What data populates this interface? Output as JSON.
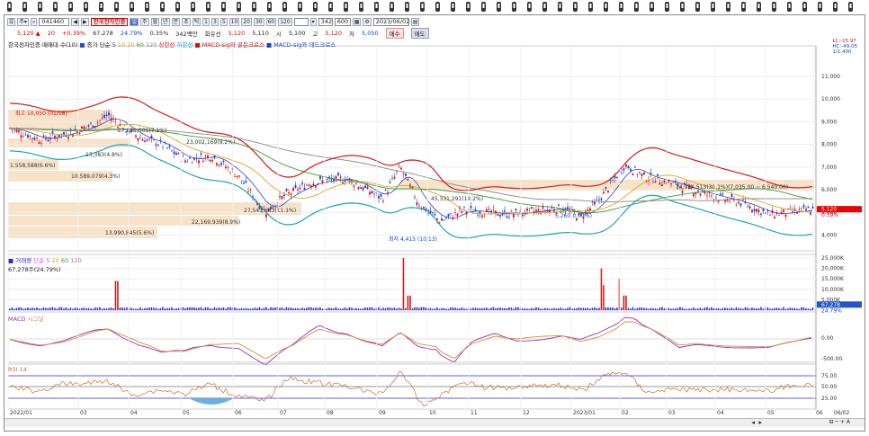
{
  "toolbar": {
    "code": "041460",
    "stock_name": "한국전자인증",
    "periods": [
      "주",
      "월",
      "년",
      "분",
      "초",
      "틱"
    ],
    "minutes": [
      "1",
      "3",
      "5",
      "10",
      "20",
      "30",
      "60",
      "120"
    ],
    "count": "342",
    "count2": "600",
    "date": "2023/06/02"
  },
  "quote": {
    "price": "5,120 ▲",
    "change": "20",
    "change_pct": "+0.39%",
    "volume": "67,278",
    "vol_ratio": "24.79%",
    "turnover_pct": "0.35%",
    "turnover": "342백만",
    "market": "회유선",
    "close_label": "5,120",
    "close2": "5,110",
    "open_label": "시",
    "open": "5,100",
    "high_label": "고",
    "high": "5,120",
    "low_label": "저",
    "low": "5,050",
    "buy_btn": "매수",
    "sell_btn": "매도"
  },
  "legends": {
    "main": "한국전자인증 매매대 수(10)",
    "ma_label": "종가 단순",
    "ma_periods": [
      "5",
      "10",
      "20",
      "60",
      "120"
    ],
    "upper": "상한선",
    "lower": "하한선",
    "macd_gold": "MACD-sig와 골든크로스",
    "macd_dead": "MACD-sig와 데드크로스",
    "vol_label": "거래량",
    "vol_ma": "단순",
    "vol_periods": [
      "5",
      "20",
      "60",
      "120"
    ],
    "vol_value": "67,278주(24.79%)",
    "macd_title": "MACD",
    "macd_sig": "시그널",
    "rsi_title": "RSI 14"
  },
  "top_right": [
    "LC:-15.97",
    "HC:-49.05",
    "1/1.400"
  ],
  "annotations": {
    "high_mark": "최고 10,050 (01/18)",
    "low_mark": "최저 4,415 (10/13)",
    "right_mark": "5,260(0.00%)",
    "bands": [
      "17,621,501(7.1%)",
      "23,002,169(9.2%)",
      "13,383(4.8%)",
      "1,558,588(6.6%)",
      "10,589,079(4.3%)",
      "45,331,291(18.2%)",
      "74,934,513(30.1%)(7,035.00 ~ 6,540.00)",
      "27,543,683(11.1%)",
      "22,169,939(8.9%)",
      "13,990,845(5.6%)"
    ]
  },
  "price_axis": [
    "11,000",
    "10,000",
    "9,000",
    "8,000",
    "7,000",
    "6,000",
    "5,000",
    "4,000"
  ],
  "price_tag": "5,120",
  "price_tag2": "0.39%",
  "vol_axis": [
    "25,000K",
    "20,000K",
    "15,000K",
    "10,000K",
    "5,000K"
  ],
  "vol_tags": [
    "67,278",
    "24.79%"
  ],
  "macd_axis": [
    "0.00",
    "-500.00"
  ],
  "rsi_axis": [
    "75.00",
    "50.00",
    "25.00"
  ],
  "x_labels": [
    "2022/01",
    "03",
    "04",
    "05",
    "06",
    "07",
    "08",
    "09",
    "10",
    "11",
    "12",
    "2023/01",
    "02",
    "03",
    "04",
    "05",
    "06"
  ],
  "bottom_right": "06/02",
  "colors": {
    "bollinger": "#d61a1a",
    "bollinger_low": "#1aa5b8",
    "ma5": "#3344cc",
    "ma20": "#e3a21b",
    "ma60": "#3a9a3a",
    "ma120": "#888888",
    "macd": "#9a2fb0",
    "signal": "#d78a3a",
    "rsi": "#d26a20",
    "volume": "#2a2ad0",
    "vol_up": "#d01010"
  }
}
